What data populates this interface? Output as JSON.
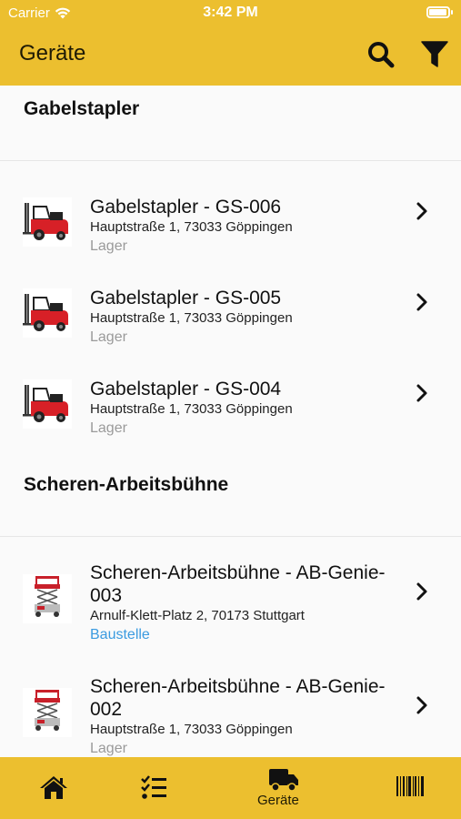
{
  "status": {
    "carrier": "Carrier",
    "time": "3:42 PM"
  },
  "header": {
    "title": "Geräte",
    "search_icon": "search-icon",
    "filter_icon": "filter-icon"
  },
  "sections": [
    {
      "title": "Gabelstapler",
      "items": [
        {
          "name": "Gabelstapler - GS-006",
          "address": "Hauptstraße 1, 73033 Göppingen",
          "location": "Lager"
        },
        {
          "name": "Gabelstapler - GS-005",
          "address": "Hauptstraße 1, 73033 Göppingen",
          "location": "Lager"
        },
        {
          "name": "Gabelstapler - GS-004",
          "address": "Hauptstraße 1, 73033 Göppingen",
          "location": "Lager"
        }
      ]
    },
    {
      "title": "Scheren-Arbeitsbühne",
      "items": [
        {
          "name": "Scheren-Arbeitsbühne - AB-Genie-003",
          "address": "Arnulf-Klett-Platz  2, 70173 Stuttgart",
          "location": "Baustelle"
        },
        {
          "name": "Scheren-Arbeitsbühne - AB-Genie-002",
          "address": "Hauptstraße 1, 73033 Göppingen",
          "location": "Lager"
        }
      ]
    }
  ],
  "tabbar": {
    "active_label": "Geräte"
  },
  "colors": {
    "brand": "#ecbf2f",
    "link": "#3a9be0",
    "muted": "#9a9a9a"
  }
}
